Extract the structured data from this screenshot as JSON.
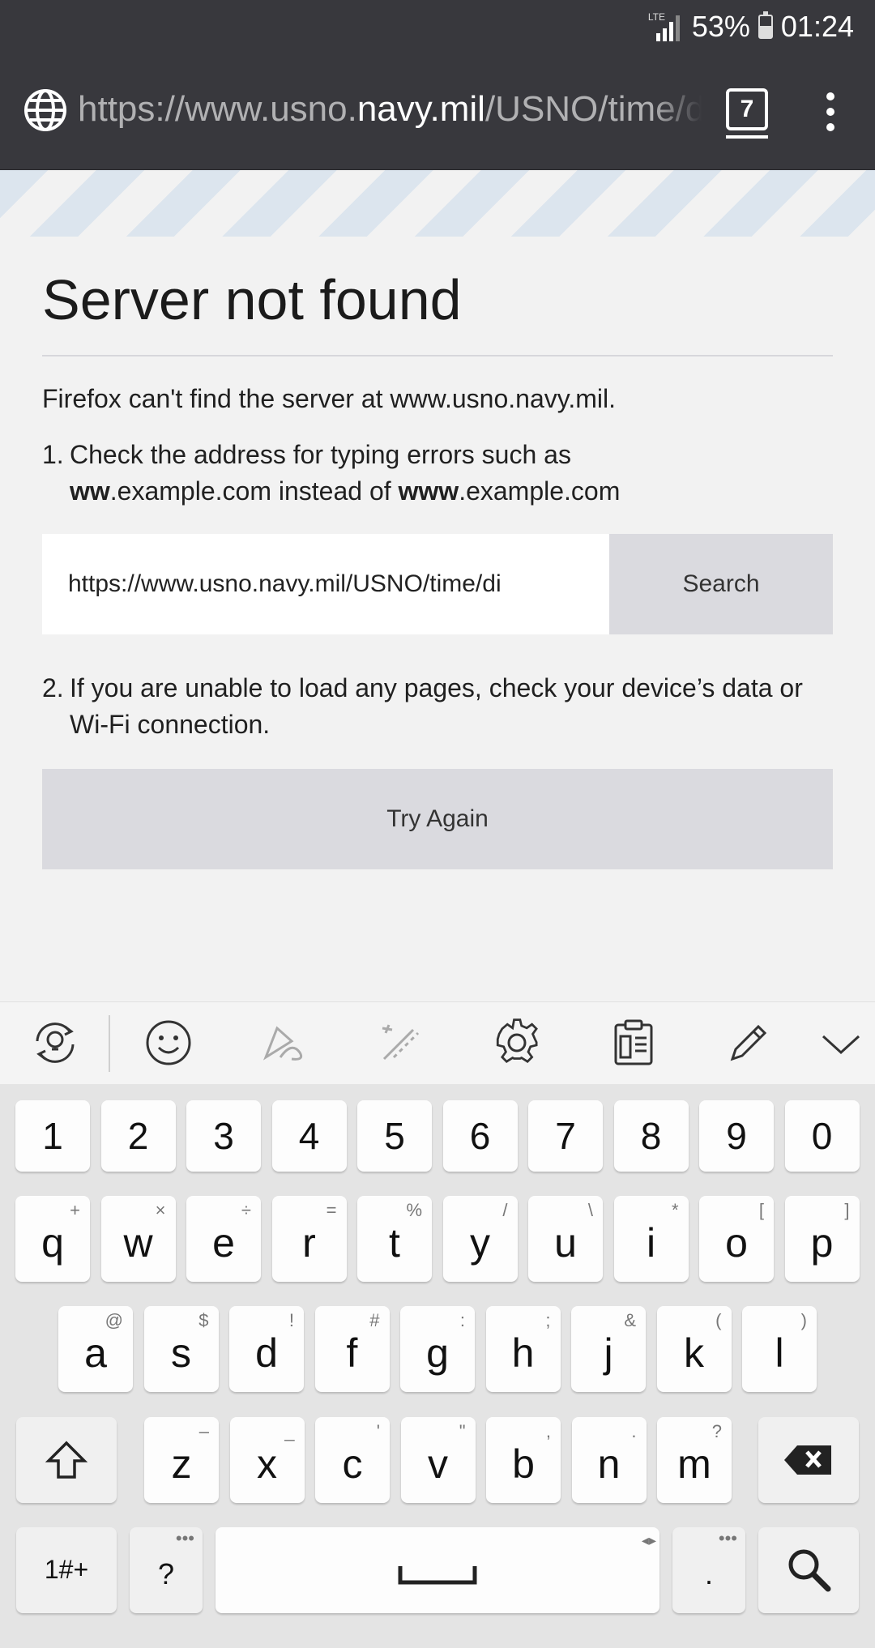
{
  "status": {
    "network": "LTE",
    "battery": "53%",
    "time": "01:24",
    "battery_level": 0.53
  },
  "browser": {
    "url_prefix": "https://www.usno.",
    "url_host": "navy.mil",
    "url_suffix": "/USNO/time/display-clocks",
    "tab_count": "7"
  },
  "error": {
    "title": "Server not found",
    "intro": "Firefox can't find the server at www.usno.navy.mil.",
    "item1_num": "1.",
    "item1_text_a": "Check the address for typing errors such as",
    "item1_bold_a": "ww",
    "item1_text_b": ".example.com instead of",
    "item1_bold_b": "www",
    "item1_text_c": ".example.com",
    "search_value": "https://www.usno.navy.mil/USNO/time/di",
    "search_button": "Search",
    "item2_num": "2.",
    "item2_text": "If you are unable to load any pages, check your device’s data or Wi-Fi connection.",
    "try_again": "Try Again"
  },
  "keyboard": {
    "toolbar": [
      "smart-tips-icon",
      "emoji-icon",
      "handwriting-icon",
      "magic-pen-icon",
      "settings-icon",
      "clipboard-icon",
      "edit-icon",
      "collapse-icon"
    ],
    "numbers": [
      "1",
      "2",
      "3",
      "4",
      "5",
      "6",
      "7",
      "8",
      "9",
      "0"
    ],
    "row1": {
      "keys": [
        "q",
        "w",
        "e",
        "r",
        "t",
        "y",
        "u",
        "i",
        "o",
        "p"
      ],
      "subs": [
        "+",
        "×",
        "÷",
        "=",
        "%",
        "/",
        "\\",
        "*",
        "[",
        "]"
      ]
    },
    "row2": {
      "keys": [
        "a",
        "s",
        "d",
        "f",
        "g",
        "h",
        "j",
        "k",
        "l"
      ],
      "subs": [
        "@",
        "$",
        "!",
        "#",
        ":",
        ";",
        "&",
        "(",
        ")"
      ]
    },
    "row3": {
      "keys": [
        "z",
        "x",
        "c",
        "v",
        "b",
        "n",
        "m"
      ],
      "subs": [
        "–",
        "_",
        "'",
        "\"",
        ",",
        ".",
        "?"
      ]
    },
    "sym_label": "1#+",
    "question_label": "?",
    "period_label": ".",
    "dots": "•••",
    "cursor_arrows": "◂▸"
  }
}
